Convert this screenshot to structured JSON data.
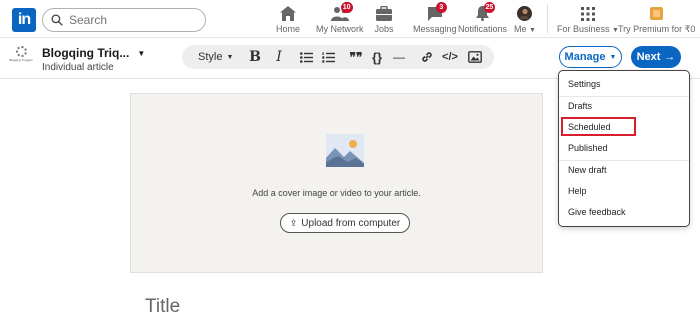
{
  "nav": {
    "logo_text": "in",
    "search_placeholder": "Search",
    "items": [
      {
        "label": "Home",
        "icon": "home-icon",
        "badge": ""
      },
      {
        "label": "My Network",
        "icon": "network-icon",
        "badge": "10"
      },
      {
        "label": "Jobs",
        "icon": "briefcase-icon",
        "badge": ""
      },
      {
        "label": "Messaging",
        "icon": "messaging-icon",
        "badge": "3"
      },
      {
        "label": "Notifications",
        "icon": "bell-icon",
        "badge": "25"
      },
      {
        "label": "Me",
        "icon": "avatar",
        "badge": ""
      }
    ],
    "for_business": "For Business",
    "premium": "Try Premium for ₹0"
  },
  "editor": {
    "company_logo_text": "Blogging Triggers",
    "author_name": "Blogqing Triq...",
    "author_sub": "Individual article",
    "toolbar": {
      "style_label": "Style",
      "bold": "B",
      "italic": "I",
      "quote": "❞❞",
      "code_braces": "{}",
      "divider": "—",
      "embed": "</>"
    },
    "manage_label": "Manage",
    "next_label": "Next",
    "cover_text": "Add a cover image or video to your article.",
    "upload_label": "Upload from computer",
    "title_placeholder": "Title"
  },
  "manage_menu": {
    "items": [
      "Settings",
      "Drafts",
      "Scheduled",
      "Published",
      "New draft",
      "Help",
      "Give feedback"
    ],
    "highlighted": "Scheduled"
  },
  "colors": {
    "brand": "#0a66c2",
    "badge": "#cb112d",
    "highlight_box": "#d81e2c"
  }
}
